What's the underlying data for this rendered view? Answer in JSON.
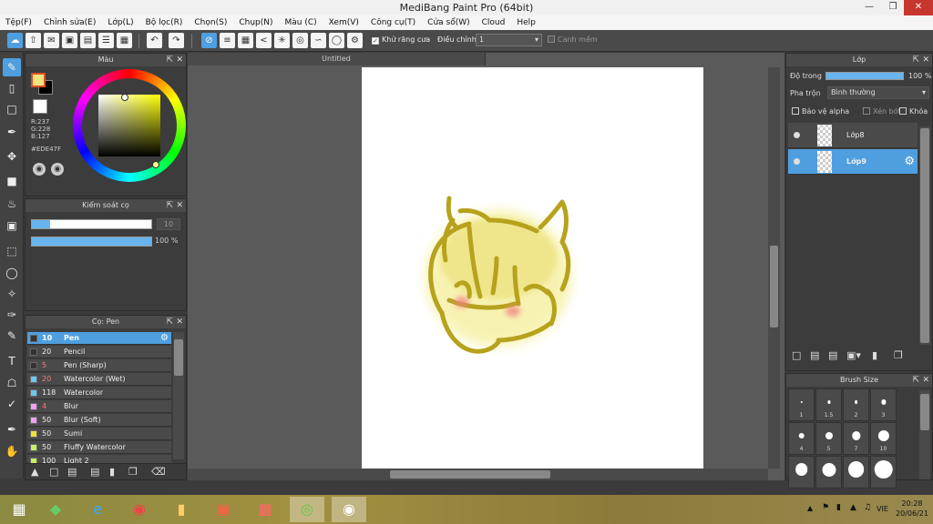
{
  "window": {
    "title": "MediBang Paint Pro (64bit)"
  },
  "menu": [
    "Tệp(F)",
    "Chỉnh sửa(E)",
    "Lớp(L)",
    "Bộ lọc(R)",
    "Chọn(S)",
    "Chụp(N)",
    "Màu (C)",
    "Xem(V)",
    "Công cụ(T)",
    "Cửa sổ(W)",
    "Cloud",
    "Help"
  ],
  "toolbar": {
    "antialias_label": "Khử răng cưa",
    "adjust_label": "Điều chỉnh",
    "adjust_value": "1",
    "snap_label": "Canh mềm"
  },
  "color_panel": {
    "title": "Màu",
    "r": "R:237",
    "g": "G:228",
    "b": "B:127",
    "hex": "#EDE47F",
    "fg_color": "#EDE47F"
  },
  "brush_control": {
    "title": "Kiểm soát cọ",
    "size_value": "10",
    "opacity_value": "100 %",
    "size_fraction": 0.15,
    "opacity_fraction": 1.0
  },
  "brush_panel": {
    "title": "Cọ: Pen",
    "brushes": [
      {
        "size": "10",
        "name": "Pen",
        "color": "#333333",
        "selected": true
      },
      {
        "size": "20",
        "name": "Pencil",
        "color": "#333333"
      },
      {
        "size": "5",
        "name": "Pen (Sharp)",
        "color": "#333333"
      },
      {
        "size": "20",
        "name": "Watercolor (Wet)",
        "color": "#6cc8f0"
      },
      {
        "size": "118",
        "name": "Watercolor",
        "color": "#6cc8f0"
      },
      {
        "size": "4",
        "name": "Blur",
        "color": "#f0a0f0"
      },
      {
        "size": "50",
        "name": "Blur (Soft)",
        "color": "#f0a0f0"
      },
      {
        "size": "50",
        "name": "Sumi",
        "color": "#f0e040"
      },
      {
        "size": "50",
        "name": "Fluffy Watercolor",
        "color": "#c8f060"
      },
      {
        "size": "100",
        "name": "Light 2",
        "color": "#c8f060"
      }
    ]
  },
  "document": {
    "tab_title": "Untitled"
  },
  "layer_panel": {
    "title": "Lớp",
    "opacity_label": "Độ trong",
    "opacity_value": "100 %",
    "blend_label": "Pha trộn",
    "blend_value": "Bình thường",
    "protect_alpha": "Bảo vệ alpha",
    "clip": "Xén bớt",
    "lock": "Khóa",
    "layers": [
      {
        "name": "Lớp8",
        "selected": false
      },
      {
        "name": "Lớp9",
        "selected": true
      }
    ]
  },
  "brush_size_panel": {
    "title": "Brush Size",
    "sizes": [
      "1",
      "1.5",
      "2",
      "3",
      "4",
      "5",
      "7",
      "10",
      "",
      "",
      "",
      ""
    ]
  },
  "taskbar": {
    "lang": "VIE",
    "time": "20:28",
    "date": "20/06/21"
  }
}
